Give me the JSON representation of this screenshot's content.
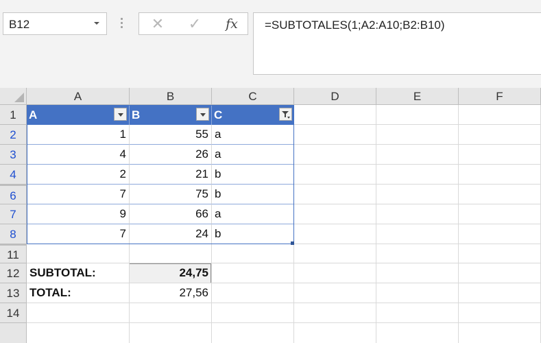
{
  "name_box": {
    "value": "B12"
  },
  "formula_bar": {
    "cancel_glyph": "✕",
    "enter_glyph": "✓",
    "fx_label": "fx",
    "formula": "=SUBTOTALES(1;A2:A10;B2:B10)"
  },
  "columns": [
    "A",
    "B",
    "C",
    "D",
    "E",
    "F"
  ],
  "table": {
    "headers": [
      "A",
      "B",
      "C"
    ],
    "rows": [
      {
        "row": "2",
        "a": "1",
        "b": "55",
        "c": "a"
      },
      {
        "row": "3",
        "a": "4",
        "b": "26",
        "c": "a"
      },
      {
        "row": "4",
        "a": "2",
        "b": "21",
        "c": "b"
      },
      {
        "row": "6",
        "a": "7",
        "b": "75",
        "c": "b"
      },
      {
        "row": "7",
        "a": "9",
        "b": "66",
        "c": "a"
      },
      {
        "row": "8",
        "a": "7",
        "b": "24",
        "c": "b"
      }
    ]
  },
  "summary": [
    {
      "row": "12",
      "label": "SUBTOTAL:",
      "value": "24,75"
    },
    {
      "row": "13",
      "label": "TOTAL:",
      "value": "27,56"
    }
  ],
  "row_headers": {
    "header_row": "1",
    "after_table": "11",
    "last": "14"
  },
  "colors": {
    "table_header": "#4472c4",
    "filtered_row_number": "#1f4fd0"
  }
}
